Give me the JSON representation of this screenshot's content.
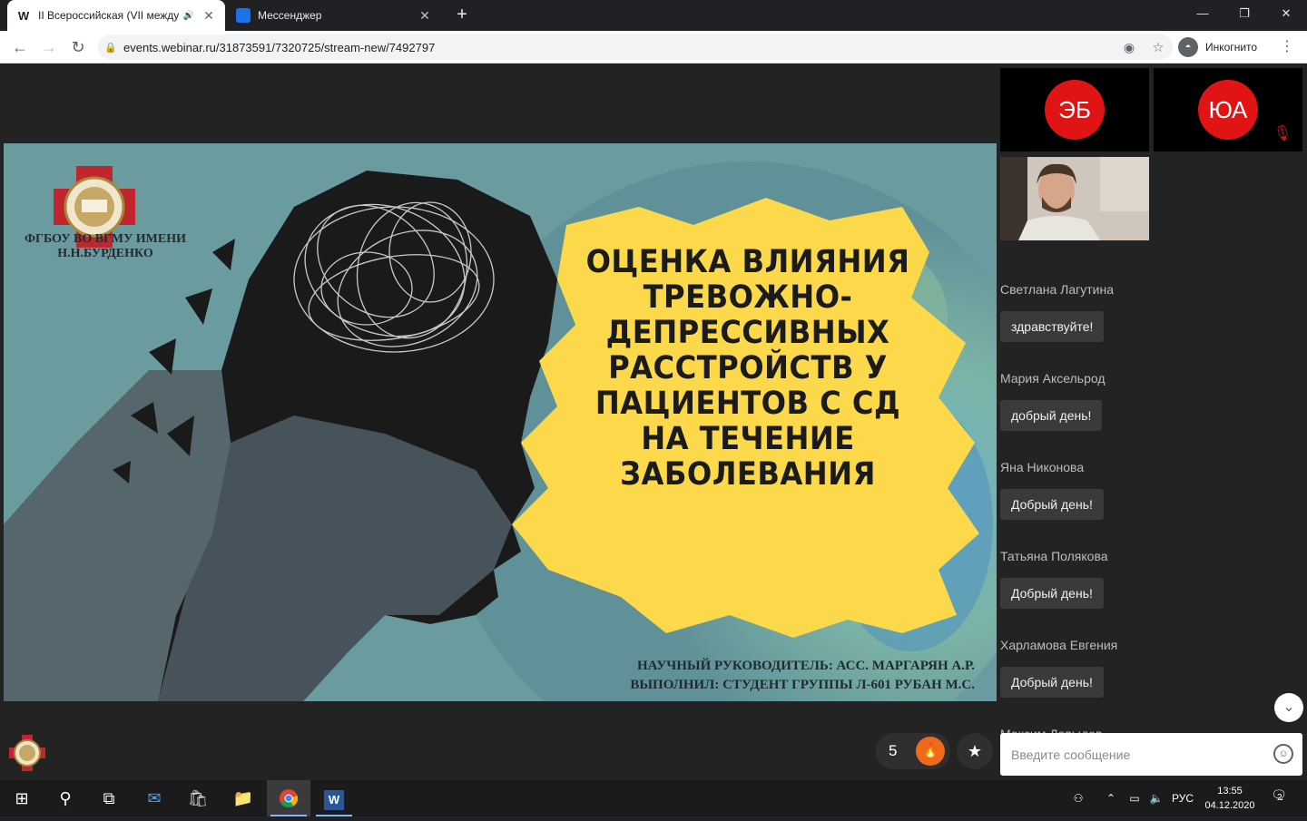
{
  "browser": {
    "tabs": [
      {
        "title": "II Всероссийская (VII между",
        "favicon": "W"
      },
      {
        "title": "Мессенджер",
        "favicon": "messenger-icon"
      }
    ],
    "url": "events.webinar.ru/31873591/7320725/stream-new/7492797",
    "incognito_label": "Инкогнито"
  },
  "slide": {
    "org": "ФГБОУ ВО ВГМУ ИМЕНИ Н.Н.БУРДЕНКО",
    "title": "ОЦЕНКА ВЛИЯНИЯ ТРЕВОЖНО-ДЕПРЕССИВНЫХ РАССТРОЙСТВ У ПАЦИЕНТОВ С СД НА ТЕЧЕНИЕ ЗАБОЛЕВАНИЯ",
    "supervisor": "НАУЧНЫЙ РУКОВОДИТЕЛЬ: АСС. МАРГАРЯН А.Р.",
    "author": "ВЫПОЛНИЛ: СТУДЕНТ ГРУППЫ Л-601 РУБАН М.С."
  },
  "participants": [
    {
      "initials": "ЭБ",
      "muted": false
    },
    {
      "initials": "ЮА",
      "muted": true
    }
  ],
  "chat": {
    "messages": [
      {
        "author": "Светлана Лагутина",
        "text": "здравствуйте!"
      },
      {
        "author": "Мария Аксельрод",
        "text": "добрый день!"
      },
      {
        "author": "Яна Никонова",
        "text": "Добрый день!"
      },
      {
        "author": "Татьяна Полякова",
        "text": "Добрый день!"
      },
      {
        "author": "Харламова Евгения",
        "text": "Добрый день!"
      },
      {
        "author": "Максим Давыдов",
        "text": ""
      }
    ],
    "input_placeholder": "Введите сообщение"
  },
  "reactions": {
    "count": "5"
  },
  "taskbar": {
    "lang": "РУС",
    "time": "13:55",
    "date": "04.12.2020",
    "notifications": "2"
  },
  "colors": {
    "accent_red": "#e01414",
    "highlight_yellow": "#fcd94a",
    "fire_orange": "#f06a1e"
  }
}
